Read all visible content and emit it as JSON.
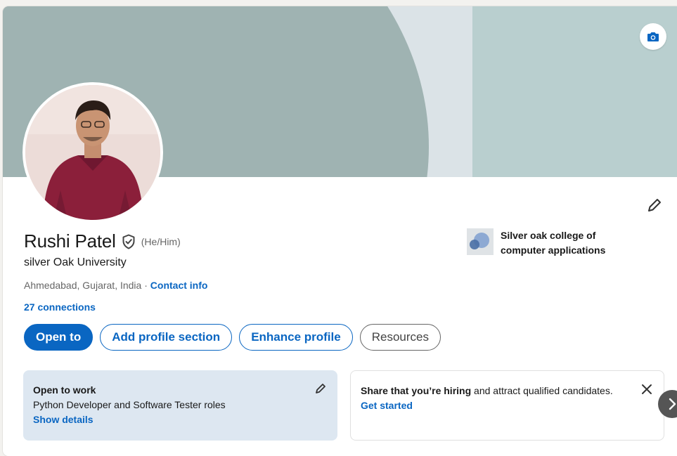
{
  "profile": {
    "name": "Rushi Patel",
    "pronouns": "(He/Him)",
    "headline": "silver Oak University",
    "location": "Ahmedabad, Gujarat, India",
    "location_sep": " · ",
    "contact_label": "Contact info",
    "connections": "27 connections"
  },
  "education": {
    "name": "Silver oak college of computer applications"
  },
  "actions": {
    "open_to": "Open to",
    "add_section": "Add profile section",
    "enhance": "Enhance profile",
    "resources": "Resources"
  },
  "open_to_work": {
    "title": "Open to work",
    "roles": "Python Developer and Software Tester roles",
    "link": "Show details"
  },
  "hiring": {
    "bold": "Share that you’re hiring",
    "rest": " and attract qualified candidates.",
    "link": "Get started"
  },
  "icons": {
    "camera": "camera-icon",
    "pencil": "pencil-icon",
    "verified": "verified-shield-icon",
    "close": "close-icon",
    "chevron": "chevron-right-icon"
  },
  "colors": {
    "accent": "#0a66c2",
    "banner_arc": "#9fb3b2",
    "banner_right": "#b9cfcf",
    "otw_bg": "#dde7f1"
  }
}
